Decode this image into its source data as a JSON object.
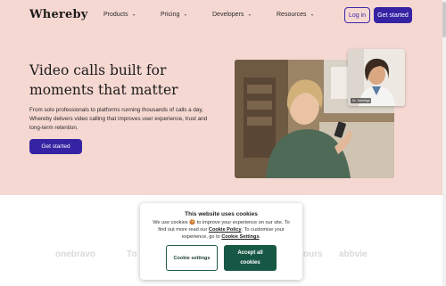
{
  "brand": {
    "name": "Whereby"
  },
  "nav": {
    "items": [
      {
        "label": "Products"
      },
      {
        "label": "Pricing"
      },
      {
        "label": "Developers"
      },
      {
        "label": "Resources"
      }
    ],
    "login_label": "Log in",
    "get_started_label": "Get started"
  },
  "hero": {
    "headline": "Video calls built for moments that matter",
    "subtext": "From solo professionals to platforms running thousands of calls a day, Whereby delivers video calling that improves user experience, trust and long-term retention.",
    "cta_label": "Get started",
    "pip_name": "Dr. Jennings"
  },
  "logos": [
    "onebravo",
    "To",
    "ours",
    "abbvie"
  ],
  "cookie": {
    "title": "This website uses cookies",
    "text_1": "We use cookies",
    "emoji": "🍪",
    "text_2": "to improve your experience on our site. To find out more read our",
    "policy_link": "Cookie Policy",
    "text_3": ". To customise your experience, go to",
    "settings_link": "Cookie Settings",
    "text_4": ".",
    "settings_button": "Cookie settings",
    "accept_button": "Accept all cookies"
  },
  "colors": {
    "hero_bg": "#f6d8d2",
    "primary": "#3523a3",
    "accept": "#175844"
  }
}
